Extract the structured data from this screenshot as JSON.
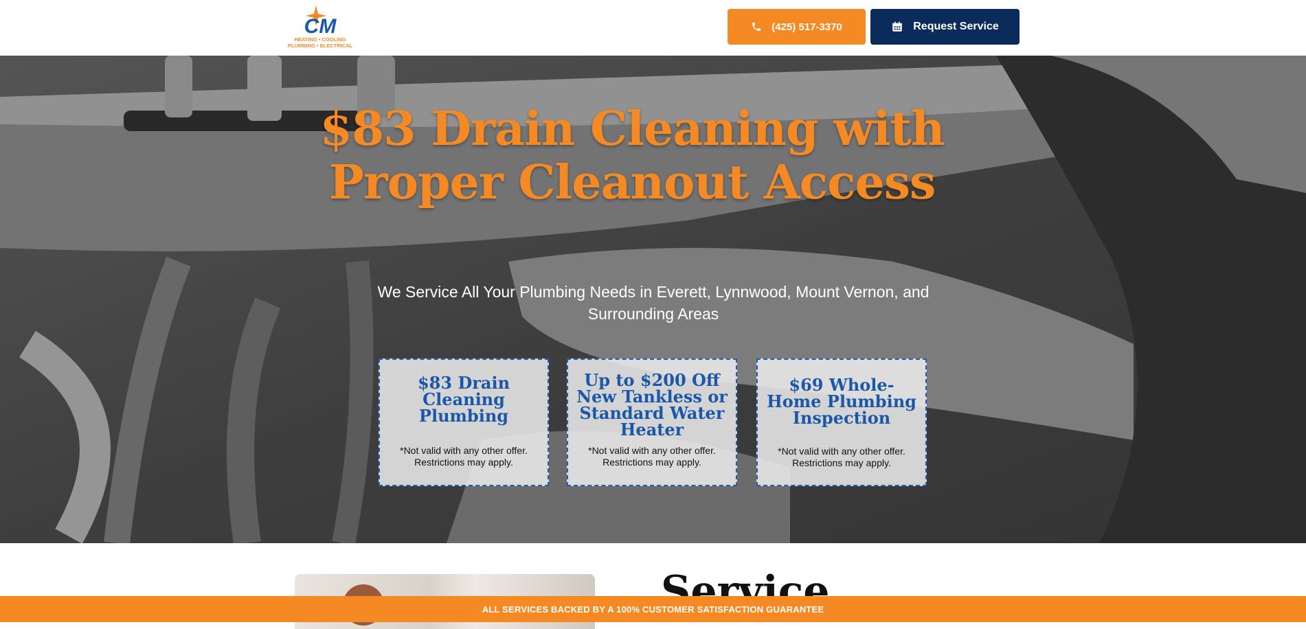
{
  "header": {
    "logo": {
      "mark": "CM",
      "line1": "HEATING • COOLING",
      "line2": "PLUMBING • ELECTRICAL"
    },
    "phone_label": "(425) 517-3370",
    "request_label": "Request Service"
  },
  "hero": {
    "title_line1": "$83 Drain Cleaning with",
    "title_line2": "Proper Cleanout Access",
    "subtitle": "We Service All Your Plumbing Needs in Everett, Lynnwood, Mount Vernon, and Surrounding Areas",
    "offers": [
      {
        "title": "$83 Drain Cleaning Plumbing",
        "note": "*Not valid with any other offer. Restrictions may apply."
      },
      {
        "title": "Up to $200 Off New Tankless or Standard Water Heater",
        "note": "*Not valid with any other offer. Restrictions may apply."
      },
      {
        "title": "$69 Whole-Home Plumbing Inspection",
        "note": "*Not valid with any other offer. Restrictions may apply."
      }
    ]
  },
  "lower": {
    "heading": "Service"
  },
  "bottom_bar": {
    "text": "ALL SERVICES BACKED BY A 100% CUSTOMER SATISFACTION GUARANTEE"
  },
  "colors": {
    "orange": "#f58a24",
    "navy": "#0b2b5a",
    "offer_blue": "#1a57a8"
  },
  "icons": {
    "phone": "phone-icon",
    "calendar": "calendar-icon"
  }
}
